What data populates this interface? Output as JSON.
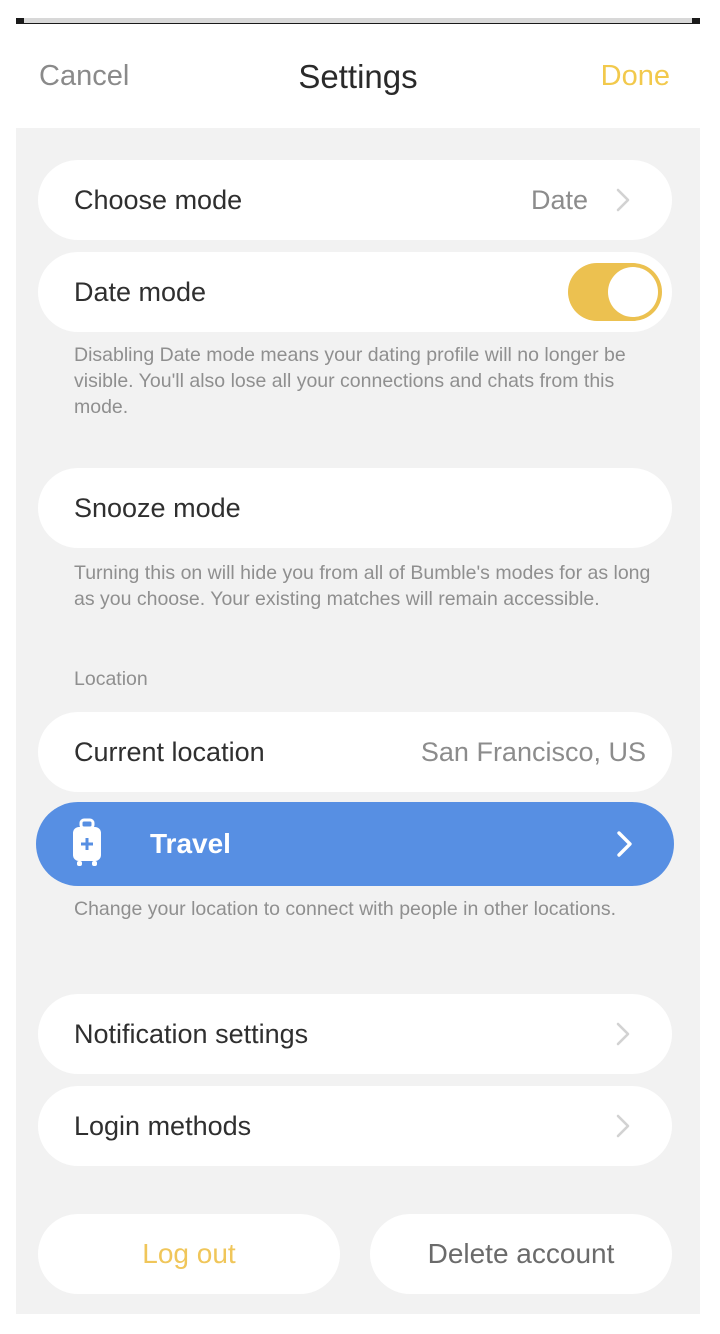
{
  "nav": {
    "cancel_label": "Cancel",
    "title": "Settings",
    "done_label": "Done"
  },
  "choose_mode": {
    "label": "Choose mode",
    "value": "Date"
  },
  "date_mode": {
    "label": "Date mode",
    "toggle_on": true,
    "note": "Disabling Date mode means your dating profile will no longer be visible. You'll also lose all your connections and chats from this mode."
  },
  "snooze_mode": {
    "label": "Snooze mode",
    "note": "Turning this on will hide you from all of Bumble's modes for as long as you choose. Your existing matches will remain accessible."
  },
  "location": {
    "section_label": "Location",
    "current_label": "Current location",
    "current_value": "San Francisco, US",
    "travel_label": "Travel",
    "travel_note": "Change your location to connect with people in other locations."
  },
  "notification_settings": {
    "label": "Notification settings"
  },
  "login_methods": {
    "label": "Login methods"
  },
  "footer": {
    "logout_label": "Log out",
    "delete_label": "Delete account"
  },
  "colors": {
    "accent_yellow": "#f2c94c",
    "toggle_yellow": "#ecc150",
    "travel_blue": "#578fe3",
    "background": "#f2f2f2"
  },
  "icons": {
    "chevron": "chevron-right-icon",
    "travel": "suitcase-icon"
  }
}
